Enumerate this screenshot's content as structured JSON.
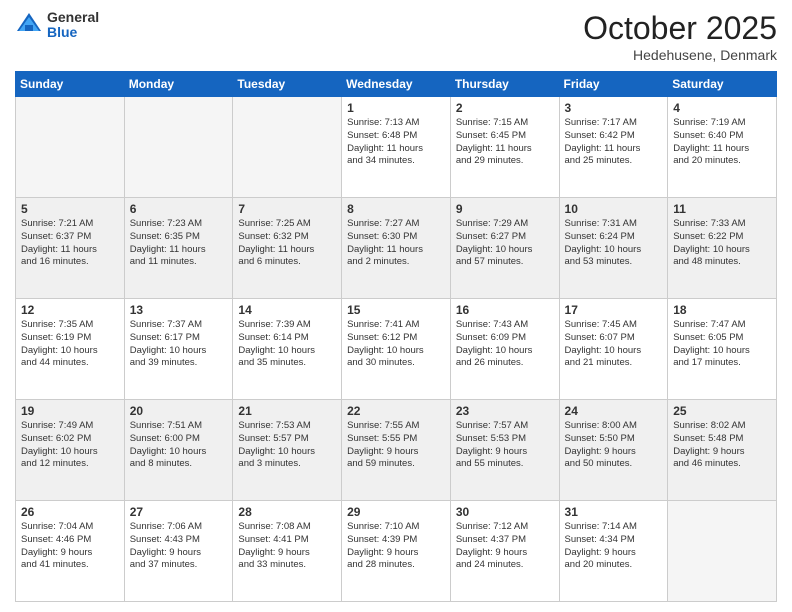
{
  "header": {
    "logo_general": "General",
    "logo_blue": "Blue",
    "month_title": "October 2025",
    "location": "Hedehusene, Denmark"
  },
  "weekdays": [
    "Sunday",
    "Monday",
    "Tuesday",
    "Wednesday",
    "Thursday",
    "Friday",
    "Saturday"
  ],
  "weeks": [
    [
      {
        "day": "",
        "info": ""
      },
      {
        "day": "",
        "info": ""
      },
      {
        "day": "",
        "info": ""
      },
      {
        "day": "1",
        "info": "Sunrise: 7:13 AM\nSunset: 6:48 PM\nDaylight: 11 hours\nand 34 minutes."
      },
      {
        "day": "2",
        "info": "Sunrise: 7:15 AM\nSunset: 6:45 PM\nDaylight: 11 hours\nand 29 minutes."
      },
      {
        "day": "3",
        "info": "Sunrise: 7:17 AM\nSunset: 6:42 PM\nDaylight: 11 hours\nand 25 minutes."
      },
      {
        "day": "4",
        "info": "Sunrise: 7:19 AM\nSunset: 6:40 PM\nDaylight: 11 hours\nand 20 minutes."
      }
    ],
    [
      {
        "day": "5",
        "info": "Sunrise: 7:21 AM\nSunset: 6:37 PM\nDaylight: 11 hours\nand 16 minutes."
      },
      {
        "day": "6",
        "info": "Sunrise: 7:23 AM\nSunset: 6:35 PM\nDaylight: 11 hours\nand 11 minutes."
      },
      {
        "day": "7",
        "info": "Sunrise: 7:25 AM\nSunset: 6:32 PM\nDaylight: 11 hours\nand 6 minutes."
      },
      {
        "day": "8",
        "info": "Sunrise: 7:27 AM\nSunset: 6:30 PM\nDaylight: 11 hours\nand 2 minutes."
      },
      {
        "day": "9",
        "info": "Sunrise: 7:29 AM\nSunset: 6:27 PM\nDaylight: 10 hours\nand 57 minutes."
      },
      {
        "day": "10",
        "info": "Sunrise: 7:31 AM\nSunset: 6:24 PM\nDaylight: 10 hours\nand 53 minutes."
      },
      {
        "day": "11",
        "info": "Sunrise: 7:33 AM\nSunset: 6:22 PM\nDaylight: 10 hours\nand 48 minutes."
      }
    ],
    [
      {
        "day": "12",
        "info": "Sunrise: 7:35 AM\nSunset: 6:19 PM\nDaylight: 10 hours\nand 44 minutes."
      },
      {
        "day": "13",
        "info": "Sunrise: 7:37 AM\nSunset: 6:17 PM\nDaylight: 10 hours\nand 39 minutes."
      },
      {
        "day": "14",
        "info": "Sunrise: 7:39 AM\nSunset: 6:14 PM\nDaylight: 10 hours\nand 35 minutes."
      },
      {
        "day": "15",
        "info": "Sunrise: 7:41 AM\nSunset: 6:12 PM\nDaylight: 10 hours\nand 30 minutes."
      },
      {
        "day": "16",
        "info": "Sunrise: 7:43 AM\nSunset: 6:09 PM\nDaylight: 10 hours\nand 26 minutes."
      },
      {
        "day": "17",
        "info": "Sunrise: 7:45 AM\nSunset: 6:07 PM\nDaylight: 10 hours\nand 21 minutes."
      },
      {
        "day": "18",
        "info": "Sunrise: 7:47 AM\nSunset: 6:05 PM\nDaylight: 10 hours\nand 17 minutes."
      }
    ],
    [
      {
        "day": "19",
        "info": "Sunrise: 7:49 AM\nSunset: 6:02 PM\nDaylight: 10 hours\nand 12 minutes."
      },
      {
        "day": "20",
        "info": "Sunrise: 7:51 AM\nSunset: 6:00 PM\nDaylight: 10 hours\nand 8 minutes."
      },
      {
        "day": "21",
        "info": "Sunrise: 7:53 AM\nSunset: 5:57 PM\nDaylight: 10 hours\nand 3 minutes."
      },
      {
        "day": "22",
        "info": "Sunrise: 7:55 AM\nSunset: 5:55 PM\nDaylight: 9 hours\nand 59 minutes."
      },
      {
        "day": "23",
        "info": "Sunrise: 7:57 AM\nSunset: 5:53 PM\nDaylight: 9 hours\nand 55 minutes."
      },
      {
        "day": "24",
        "info": "Sunrise: 8:00 AM\nSunset: 5:50 PM\nDaylight: 9 hours\nand 50 minutes."
      },
      {
        "day": "25",
        "info": "Sunrise: 8:02 AM\nSunset: 5:48 PM\nDaylight: 9 hours\nand 46 minutes."
      }
    ],
    [
      {
        "day": "26",
        "info": "Sunrise: 7:04 AM\nSunset: 4:46 PM\nDaylight: 9 hours\nand 41 minutes."
      },
      {
        "day": "27",
        "info": "Sunrise: 7:06 AM\nSunset: 4:43 PM\nDaylight: 9 hours\nand 37 minutes."
      },
      {
        "day": "28",
        "info": "Sunrise: 7:08 AM\nSunset: 4:41 PM\nDaylight: 9 hours\nand 33 minutes."
      },
      {
        "day": "29",
        "info": "Sunrise: 7:10 AM\nSunset: 4:39 PM\nDaylight: 9 hours\nand 28 minutes."
      },
      {
        "day": "30",
        "info": "Sunrise: 7:12 AM\nSunset: 4:37 PM\nDaylight: 9 hours\nand 24 minutes."
      },
      {
        "day": "31",
        "info": "Sunrise: 7:14 AM\nSunset: 4:34 PM\nDaylight: 9 hours\nand 20 minutes."
      },
      {
        "day": "",
        "info": ""
      }
    ]
  ]
}
